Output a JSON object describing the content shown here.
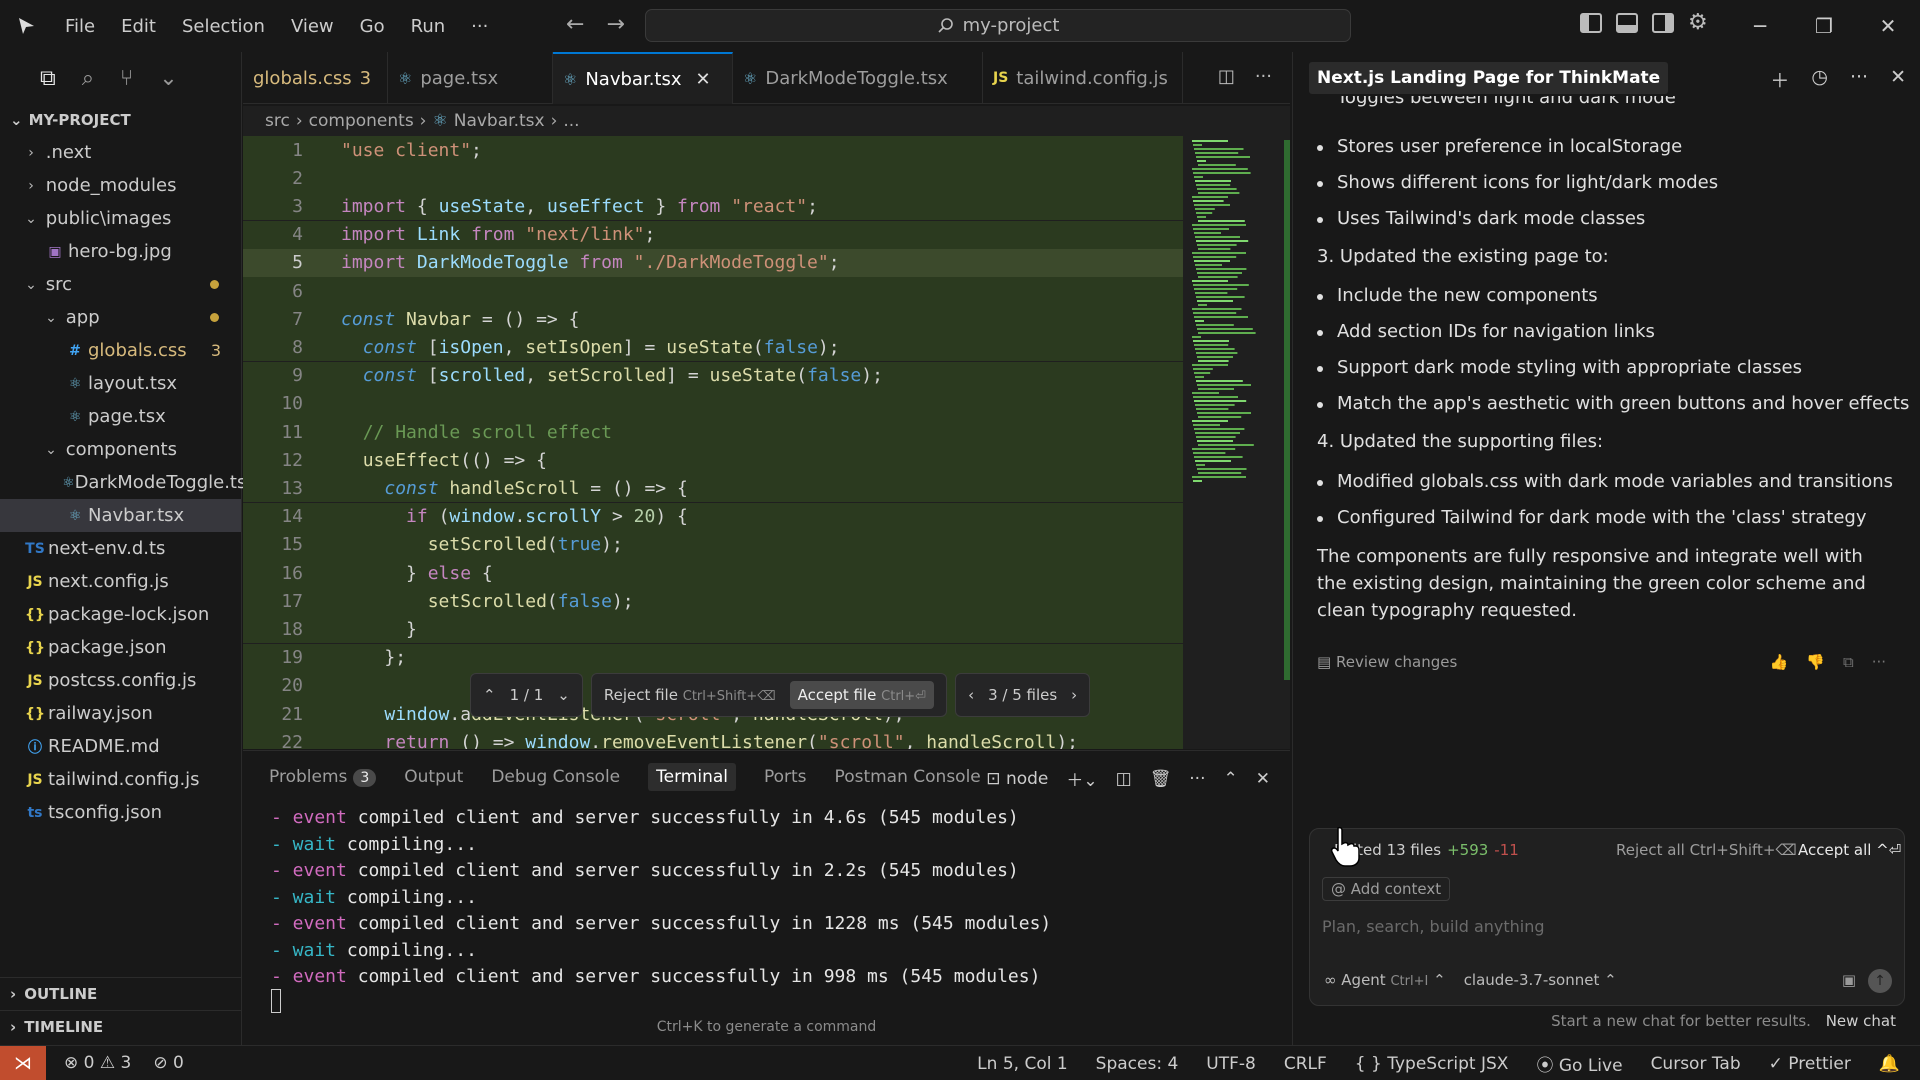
{
  "menu": [
    "File",
    "Edit",
    "Selection",
    "View",
    "Go",
    "Run",
    "···"
  ],
  "search": {
    "label": "my-project"
  },
  "explorer": {
    "project": "MY-PROJECT",
    "items": [
      {
        "label": ".next",
        "type": "folder",
        "depth": 0,
        "open": false
      },
      {
        "label": "node_modules",
        "type": "folder",
        "depth": 0,
        "open": false
      },
      {
        "label": "public\\images",
        "type": "folder",
        "depth": 0,
        "open": true
      },
      {
        "label": "hero-bg.jpg",
        "type": "image",
        "depth": 1
      },
      {
        "label": "src",
        "type": "folder",
        "depth": 0,
        "open": true,
        "modified": true
      },
      {
        "label": "app",
        "type": "folder",
        "depth": 1,
        "open": true,
        "modified": true
      },
      {
        "label": "globals.css",
        "type": "css",
        "depth": 2,
        "badge": "3"
      },
      {
        "label": "layout.tsx",
        "type": "react",
        "depth": 2
      },
      {
        "label": "page.tsx",
        "type": "react",
        "depth": 2
      },
      {
        "label": "components",
        "type": "folder",
        "depth": 1,
        "open": true
      },
      {
        "label": "DarkModeToggle.tsx",
        "type": "react",
        "depth": 2
      },
      {
        "label": "Navbar.tsx",
        "type": "react",
        "depth": 2,
        "selected": true
      },
      {
        "label": "next-env.d.ts",
        "type": "ts",
        "depth": 0
      },
      {
        "label": "next.config.js",
        "type": "js",
        "depth": 0
      },
      {
        "label": "package-lock.json",
        "type": "json",
        "depth": 0
      },
      {
        "label": "package.json",
        "type": "json",
        "depth": 0
      },
      {
        "label": "postcss.config.js",
        "type": "js",
        "depth": 0
      },
      {
        "label": "railway.json",
        "type": "json",
        "depth": 0
      },
      {
        "label": "README.md",
        "type": "info",
        "depth": 0
      },
      {
        "label": "tailwind.config.js",
        "type": "js",
        "depth": 0
      },
      {
        "label": "tsconfig.json",
        "type": "tsconfig",
        "depth": 0
      }
    ],
    "outline": "OUTLINE",
    "timeline": "TIMELINE"
  },
  "tabs": [
    {
      "label": "globals.css",
      "badge": "3",
      "icon": "#",
      "modified": true
    },
    {
      "label": "page.tsx",
      "icon": "⚛"
    },
    {
      "label": "Navbar.tsx",
      "icon": "⚛",
      "active": true
    },
    {
      "label": "DarkModeToggle.tsx",
      "icon": "⚛"
    },
    {
      "label": "tailwind.config.js",
      "icon": "JS"
    }
  ],
  "breadcrumb": [
    "src",
    "components",
    "Navbar.tsx",
    "..."
  ],
  "code_lines": [
    {
      "n": "1",
      "html": "<span class='s'>\"use client\"</span><span class='p'>;</span>",
      "added": true
    },
    {
      "n": "2",
      "html": "",
      "added": true
    },
    {
      "n": "3",
      "html": "<span class='k'>import</span> <span class='p'>{ </span><span class='v'>useState</span><span class='p'>, </span><span class='v'>useEffect</span><span class='p'> } </span><span class='k'>from</span> <span class='s'>\"react\"</span><span class='p'>;</span>",
      "added": true
    },
    {
      "n": "4",
      "html": "<span class='k'>import</span> <span class='v'>Link</span> <span class='k'>from</span> <span class='s'>\"next/link\"</span><span class='p'>;</span>",
      "added": true
    },
    {
      "n": "5",
      "html": "<span class='k'>import</span> <span class='v'>DarkModeToggle</span> <span class='k'>from</span> <span class='s'>\"./DarkModeToggle\"</span><span class='p'>;</span>",
      "added": true,
      "hl": true,
      "cur": true
    },
    {
      "n": "6",
      "html": "",
      "added": true
    },
    {
      "n": "7",
      "html": "<span class='kb'>const</span> <span class='f'>Navbar</span> <span class='p'>= () =&gt; {</span>",
      "added": true
    },
    {
      "n": "8",
      "html": "  <span class='kb'>const</span> <span class='p'>[</span><span class='v'>isOpen</span><span class='p'>, </span><span class='f'>setIsOpen</span><span class='p'>] = </span><span class='f'>useState</span><span class='p'>(</span><span class='b'>false</span><span class='p'>);</span>",
      "added": true
    },
    {
      "n": "9",
      "html": "  <span class='kb'>const</span> <span class='p'>[</span><span class='v'>scrolled</span><span class='p'>, </span><span class='f'>setScrolled</span><span class='p'>] = </span><span class='f'>useState</span><span class='p'>(</span><span class='b'>false</span><span class='p'>);</span>",
      "added": true
    },
    {
      "n": "10",
      "html": "",
      "added": true
    },
    {
      "n": "11",
      "html": "  <span class='c'>// Handle scroll effect</span>",
      "added": true
    },
    {
      "n": "12",
      "html": "  <span class='f'>useEffect</span><span class='p'>(() =&gt; {</span>",
      "added": true
    },
    {
      "n": "13",
      "html": "    <span class='kb'>const</span> <span class='f'>handleScroll</span> <span class='p'>= () =&gt; {</span>",
      "added": true
    },
    {
      "n": "14",
      "html": "      <span class='k'>if</span> <span class='p'>(</span><span class='v'>window</span><span class='p'>.</span><span class='v'>scrollY</span> <span class='p'>&gt; </span><span class='n'>20</span><span class='p'>) {</span>",
      "added": true
    },
    {
      "n": "15",
      "html": "        <span class='f'>setScrolled</span><span class='p'>(</span><span class='b'>true</span><span class='p'>);</span>",
      "added": true
    },
    {
      "n": "16",
      "html": "      <span class='p'>} </span><span class='k'>else</span><span class='p'> {</span>",
      "added": true
    },
    {
      "n": "17",
      "html": "        <span class='f'>setScrolled</span><span class='p'>(</span><span class='b'>false</span><span class='p'>);</span>",
      "added": true
    },
    {
      "n": "18",
      "html": "      <span class='p'>}</span>",
      "added": true
    },
    {
      "n": "19",
      "html": "    <span class='p'>};</span>",
      "added": true
    },
    {
      "n": "20",
      "html": "",
      "added": true
    },
    {
      "n": "21",
      "html": "    <span class='v'>window</span><span class='p'>.a</span><span class='f'>ddEventListener</span><span class='p'>(</span><span class='s'>\"scroll\"</span><span class='p'>, </span><span class='f'>handleScroll</span><span class='p'>);</span>",
      "added": true
    },
    {
      "n": "22",
      "html": "    <span class='k'>return</span> <span class='p'>() =&gt; </span><span class='v'>window</span><span class='p'>.</span><span class='f'>removeEventListener</span><span class='p'>(</span><span class='s'>\"scroll\"</span><span class='p'>, </span><span class='f'>handleScroll</span><span class='p'>);</span>",
      "added": true
    }
  ],
  "diff_toolbar": {
    "nav": "1 / 1",
    "reject_label": "Reject file",
    "reject_shortcut": "Ctrl+Shift+⌫",
    "accept_label": "Accept file",
    "accept_shortcut": "Ctrl+⏎",
    "files": "3 / 5 files"
  },
  "panel": {
    "tabs": [
      "Problems",
      "Output",
      "Debug Console",
      "Terminal",
      "Ports",
      "Postman Console"
    ],
    "problems_count": "3",
    "active_tab": "Terminal",
    "shell": "node",
    "terminal": [
      {
        "kind": "event",
        "text": "compiled client and server successfully in 4.6s (545 modules)"
      },
      {
        "kind": "wait",
        "text": "compiling..."
      },
      {
        "kind": "event",
        "text": "compiled client and server successfully in 2.2s (545 modules)"
      },
      {
        "kind": "wait",
        "text": "compiling..."
      },
      {
        "kind": "event",
        "text": "compiled client and server successfully in 1228 ms (545 modules)"
      },
      {
        "kind": "wait",
        "text": "compiling..."
      },
      {
        "kind": "event",
        "text": "compiled client and server successfully in 998 ms (545 modules)"
      }
    ],
    "hint": "Ctrl+K to generate a command"
  },
  "chat": {
    "title": "Next.js Landing Page for ThinkMate",
    "partial_line": "Toggles between light and dark mode",
    "blocks": [
      {
        "type": "bullet",
        "text": "Stores user preference in localStorage"
      },
      {
        "type": "bullet",
        "text": "Shows different icons for light/dark modes"
      },
      {
        "type": "bullet",
        "text": "Uses Tailwind's dark mode classes"
      },
      {
        "type": "num",
        "text": "3. Updated the existing page to:"
      },
      {
        "type": "bullet",
        "text": "Include the new components"
      },
      {
        "type": "bullet",
        "text": "Add section IDs for navigation links"
      },
      {
        "type": "bullet",
        "text": "Support dark mode styling with appropriate classes"
      },
      {
        "type": "bullet",
        "text": "Match the app's aesthetic with green buttons and hover effects"
      },
      {
        "type": "num",
        "text": "4. Updated the supporting files:"
      },
      {
        "type": "bullet",
        "text": "Modified globals.css with dark mode variables and transitions"
      },
      {
        "type": "bullet",
        "text": "Configured Tailwind for dark mode with the 'class' strategy"
      }
    ],
    "summary": "The components are fully responsive and integrate well with the existing design, maintaining the green color scheme and clean typography requested.",
    "review_label": "Review changes",
    "composer": {
      "edited": "Edited 13 files",
      "added": "+593",
      "removed": "-11",
      "reject_all": "Reject all Ctrl+Shift+⌫",
      "accept_all": "Accept all ^⏎",
      "add_context": "Add context",
      "placeholder": "Plan, search, build anything",
      "mode": "Agent",
      "mode_shortcut": "Ctrl+I",
      "model": "claude-3.7-sonnet"
    },
    "new_chat_hint": "Start a new chat for better results.",
    "new_chat_label": "New chat"
  },
  "status": {
    "errors": "0",
    "warnings": "3",
    "ports": "0",
    "position": "Ln 5, Col 1",
    "spaces": "Spaces: 4",
    "encoding": "UTF-8",
    "eol": "CRLF",
    "language": "TypeScript JSX",
    "golive": "Go Live",
    "cursor_tab": "Cursor Tab",
    "prettier": "Prettier"
  },
  "colors": {
    "accent": "#0078d4",
    "added_bg": "#2b3a1f",
    "remote": "#c14d2e"
  }
}
